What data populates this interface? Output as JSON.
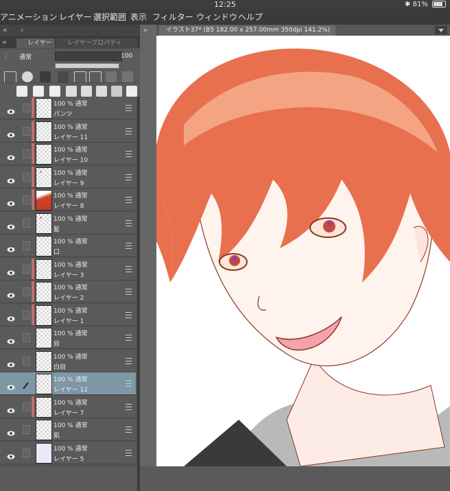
{
  "status": {
    "time": "12:25",
    "battery": "81%"
  },
  "menu": [
    "アニメーション",
    "レイヤー",
    "選択範囲",
    "表示",
    "フィルター",
    "ウィンドウ",
    "ヘルプ"
  ],
  "panel": {
    "tab_layer": "レイヤー",
    "tab_property": "レイヤープロパティ",
    "blend_mode": "通常",
    "opacity": "100"
  },
  "document": {
    "tab_title": "イラスト37* (B5 182.00 x 257.00mm 350dpi 141.2%)"
  },
  "layers": [
    {
      "line1": "100 % 通常",
      "line2": "パンツ",
      "mask": true,
      "selected": false,
      "thumb": "blank"
    },
    {
      "line1": "100 % 通常",
      "line2": "レイヤー 11",
      "mask": true,
      "selected": false,
      "thumb": "blank"
    },
    {
      "line1": "100 % 通常",
      "line2": "レイヤー 10",
      "mask": true,
      "selected": false,
      "thumb": "blank"
    },
    {
      "line1": "100 % 通常",
      "line2": "レイヤー 9",
      "mask": true,
      "selected": false,
      "thumb": "dots"
    },
    {
      "line1": "100 % 通常",
      "line2": "レイヤー 8",
      "mask": true,
      "selected": false,
      "thumb": "hair"
    },
    {
      "line1": "100 % 通常",
      "line2": "髪",
      "mask": false,
      "selected": false,
      "thumb": "dots"
    },
    {
      "line1": "100 % 通常",
      "line2": "口",
      "mask": false,
      "selected": false,
      "thumb": "blank"
    },
    {
      "line1": "100 % 通常",
      "line2": "レイヤー 3",
      "mask": true,
      "selected": false,
      "thumb": "blank"
    },
    {
      "line1": "100 % 通常",
      "line2": "レイヤー 2",
      "mask": true,
      "selected": false,
      "thumb": "blank"
    },
    {
      "line1": "100 % 通常",
      "line2": "レイヤー 1",
      "mask": true,
      "selected": false,
      "thumb": "blank"
    },
    {
      "line1": "100 % 通常",
      "line2": "目",
      "mask": false,
      "selected": false,
      "thumb": "blank"
    },
    {
      "line1": "100 % 通常",
      "line2": "白目",
      "mask": false,
      "selected": false,
      "thumb": "blank"
    },
    {
      "line1": "100 % 通常",
      "line2": "レイヤー 12",
      "mask": false,
      "selected": true,
      "thumb": "blank"
    },
    {
      "line1": "100 % 通常",
      "line2": "レイヤー 7",
      "mask": true,
      "selected": false,
      "thumb": "blank"
    },
    {
      "line1": "100 % 通常",
      "line2": "肌",
      "mask": false,
      "selected": false,
      "thumb": "blank"
    },
    {
      "line1": "100 % 通常",
      "line2": "レイヤー 5",
      "mask": false,
      "selected": false,
      "thumb": "lavender"
    }
  ],
  "colors": {
    "hair": "#e8704f",
    "hair_light": "#f6b28f",
    "skin": "#fff2ec",
    "line": "#8a3520",
    "hoodie": "#b7b7b7",
    "selected_layer": "#7d97a6",
    "mask_bar": "#c96a6a"
  },
  "icons": [
    "eye-icon",
    "lock-icon",
    "pen-icon",
    "new-layer-icon",
    "folder-icon",
    "trash-icon",
    "chevron-left-icon",
    "chevron-down-icon"
  ]
}
